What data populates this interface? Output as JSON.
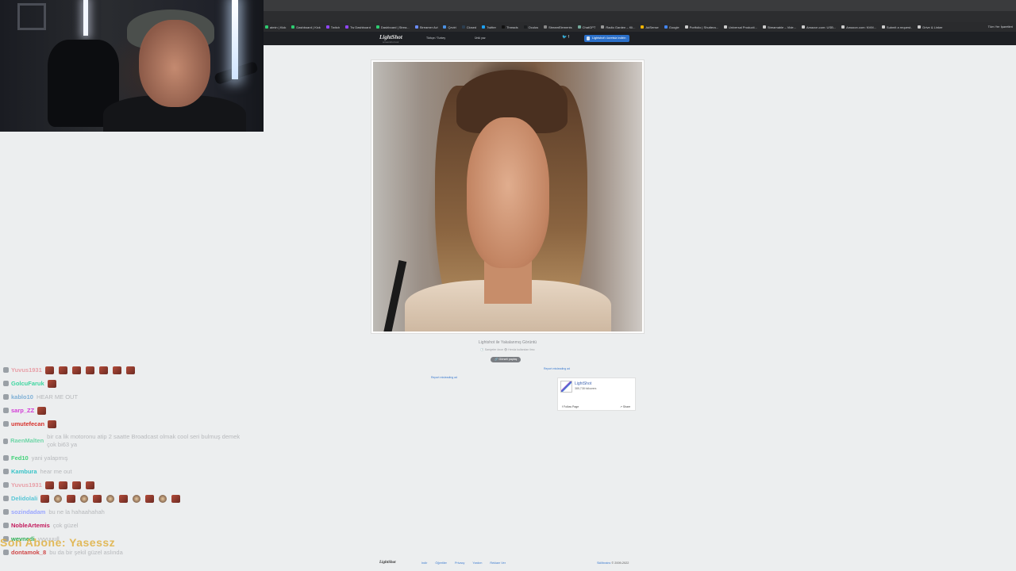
{
  "browser": {
    "bookmarks": [
      "aimin | Kick",
      "Dashboard | Kick",
      "Twitch",
      "Tw Dashboard",
      "Dashboard | Strea...",
      "Streamer Avi",
      "Çeviri",
      "Closed",
      "Twitter",
      "Threads",
      "Oculus",
      "StreamElements",
      "ChatGPT",
      "Radio Garden – Kli...",
      "AdSense",
      "Google",
      "Portfolio | Shuttera...",
      "Universal Producti...",
      "Streamable – Vide...",
      "Amazon.com: USB...",
      "Amazon.com: NVM...",
      "Submit a request..",
      "Drive & Linker"
    ],
    "bookmarks_right": "Tüm Yer İşaretleri",
    "bookmark_colors": [
      "#2ecc71",
      "#2ecc71",
      "#9146ff",
      "#9146ff",
      "#2ecc71",
      "#6b8cff",
      "#4a90e2",
      "#2c3e50",
      "#1da1f2",
      "#111111",
      "#1c1e20",
      "#888888",
      "#74aa9c",
      "#999999",
      "#f4b400",
      "#4285f4",
      "#cccccc",
      "#cccccc",
      "#cccccc",
      "#cccccc",
      "#cccccc",
      "#cccccc",
      "#cccccc"
    ]
  },
  "lightshot": {
    "logo": "LightShot",
    "logo_sub": "screenshot tool",
    "language": "Türkçe / Turkey",
    "header_link": "Ünlü yaz",
    "social": "🐦 f",
    "download_label": "Lightshot'ı ücretsiz indirin",
    "caption": "Lightshot ile Yakalanmış Görüntü",
    "caption_meta": "🕓 Saniyeler önce   👁 Henüz kullanılan ilmo",
    "share_label": "🔗 Görseli paylaş",
    "report_1": "Report misleading ad",
    "report_2": "Report misleading ad",
    "fb": {
      "name": "LightShot",
      "followers": "385,738 followers",
      "follow": "f Follow Page",
      "share": "↗ Share"
    },
    "footer": {
      "logo": "LightShot",
      "links": [
        "Indir",
        "Öğretiler",
        "Privacy",
        "Yardım",
        "Reklam Ver"
      ],
      "copy_link": "Skillbrains",
      "copy_text": " © 2009-2022"
    }
  },
  "chat": [
    {
      "user": "Yuvus1931",
      "color": "#e8a0a8",
      "text": "",
      "emotes": 7
    },
    {
      "user": "GolcuFaruk",
      "color": "#3fd7a1",
      "text": "",
      "emotes": 1
    },
    {
      "user": "kablo10",
      "color": "#7fb0d6",
      "text": "HEAR ME OUT",
      "emotes": 0
    },
    {
      "user": "sarp_ZZ",
      "color": "#d23bd6",
      "text": "",
      "emotes": 1
    },
    {
      "user": "umutefecan",
      "color": "#d7322d",
      "text": "",
      "emotes": 1
    },
    {
      "user": "RaenMalten",
      "color": "#6fd6a8",
      "text": "bir ca lik motoronu atip 2 saatte Broadcast olmak cool seri bulmuş demek çok bi63 ya",
      "emotes": 0
    },
    {
      "user": "Fed10",
      "color": "#44d27a",
      "text": "yani yalapmış",
      "emotes": 0
    },
    {
      "user": "Kambura",
      "color": "#3bc4c8",
      "text": "hear me out",
      "emotes": 0
    },
    {
      "user": "Yuvus1931",
      "color": "#e8a0a8",
      "text": "",
      "emotes": 4
    },
    {
      "user": "Delidolali",
      "color": "#58c6d6",
      "text": "",
      "emotes": 11
    },
    {
      "user": "sozindadam",
      "color": "#9aa6ff",
      "text": "bu ne la hahaahahah",
      "emotes": 0
    },
    {
      "user": "NobleArtemis",
      "color": "#c2185b",
      "text": "çok güzel",
      "emotes": 0
    },
    {
      "user": "wevnedi",
      "color": "#2fae54",
      "text": "yyyuuull",
      "emotes": 0
    },
    {
      "user": "dontamok_8",
      "color": "#d04a4a",
      "text": "bu da bir şekil güzel aslında",
      "emotes": 0
    }
  ],
  "chat_overlay": "Son Abone: Yasessz"
}
